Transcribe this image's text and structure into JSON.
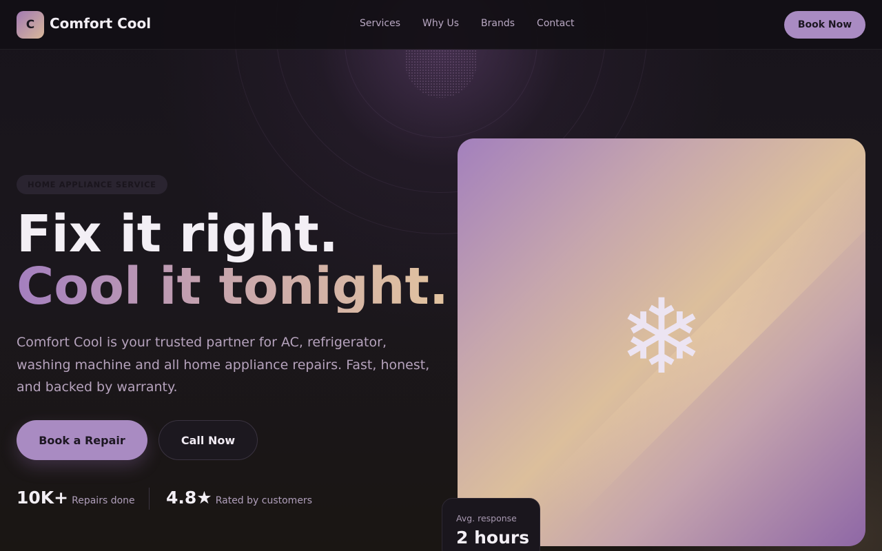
{
  "brand": {
    "logo_letter": "C",
    "name": "Comfort Cool"
  },
  "nav": {
    "items": [
      {
        "label": "Services"
      },
      {
        "label": "Why Us"
      },
      {
        "label": "Brands"
      },
      {
        "label": "Contact"
      }
    ],
    "cta_label": "Book Now"
  },
  "hero": {
    "eyebrow": "HOME APPLIANCE SERVICE",
    "headline_line1": "Fix it right.",
    "headline_line2": "Cool it tonight.",
    "description": "Comfort Cool is your trusted partner for AC, refrigerator, washing machine and all home appliance repairs. Fast, honest, and backed by warranty.",
    "primary_button": "Book a Repair",
    "secondary_button": "Call Now",
    "stats": [
      {
        "value": "10K+",
        "label": "Repairs done"
      },
      {
        "value": "4.8★",
        "label": "Rated by customers"
      }
    ]
  },
  "visual": {
    "icon": "snowflake-icon",
    "glyph": "❄",
    "response_label": "Avg. response",
    "response_value": "2 hours"
  },
  "colors": {
    "accent": "#a98bc2",
    "background": "#141116",
    "gradient_start": "#a47fbf",
    "gradient_end": "#e2c39f"
  }
}
